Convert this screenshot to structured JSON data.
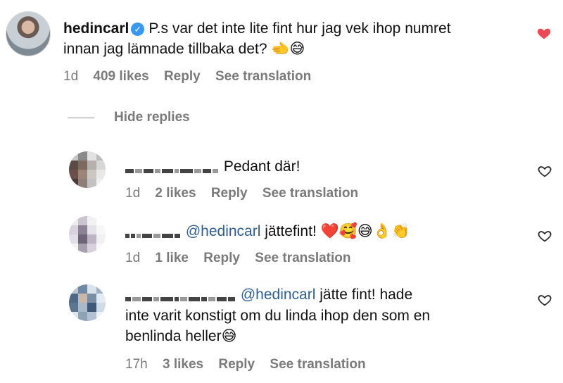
{
  "comments": [
    {
      "avatar_icon": "profile-photo",
      "username": "hedincarl",
      "verified": true,
      "text_line1": "P.s var det inte lite fint hur jag vek ihop numret",
      "text_line2": "innan jag lämnade tillbaka det? 🫲😅",
      "time": "1d",
      "likes": "409 likes",
      "reply": "Reply",
      "translate": "See translation",
      "liked": true,
      "heart_color": "#ed4956"
    },
    {
      "username_masked": true,
      "text": "Pedant där!",
      "time": "1d",
      "likes": "2 likes",
      "reply": "Reply",
      "translate": "See translation",
      "liked": false
    },
    {
      "username_masked": true,
      "mention": "@hedincarl",
      "text": "jättefint! ❤️🥰😅👌👏",
      "time": "1d",
      "likes": "1 like",
      "reply": "Reply",
      "translate": "See translation",
      "liked": false
    },
    {
      "username_masked": true,
      "mention": "@hedincarl",
      "text_line1": "jätte fint! hade",
      "text_line2": "inte varit konstigt om du linda ihop den som en",
      "text_line3": "benlinda heller😅",
      "time": "17h",
      "likes": "3 likes",
      "reply": "Reply",
      "translate": "See translation",
      "liked": false
    }
  ],
  "hide_replies_label": "Hide replies",
  "colors": {
    "mention": "#2f5f95",
    "meta": "#7a7a7a",
    "heart_liked": "#ed4956",
    "verified": "#3897f0"
  }
}
